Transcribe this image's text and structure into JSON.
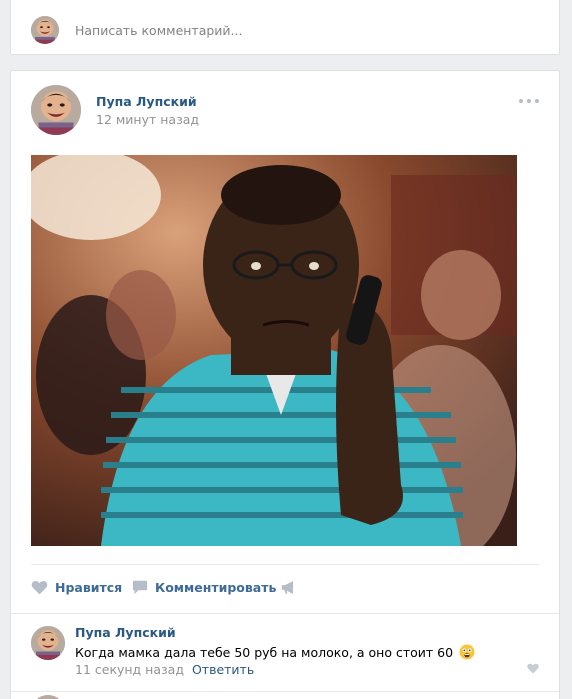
{
  "composer": {
    "placeholder": "Написать комментарий..."
  },
  "post": {
    "author": "Пупа Лупский",
    "time": "12 минут назад",
    "menu_icon": "more-dots-icon",
    "photo_alt": "meme-photo"
  },
  "actions": {
    "like_label": "Нравится",
    "comment_label": "Комментировать",
    "share_icon": "megaphone-icon"
  },
  "comment": {
    "author": "Пупа Лупский",
    "text": "Когда мамка дала тебе 50 руб на молоко, а оно стоит 60",
    "emoji": "scared-face-emoji",
    "time": "11 секунд назад",
    "reply_label": "Ответить"
  },
  "colors": {
    "link": "#2a5885",
    "action": "#3d6a98",
    "muted": "#939393",
    "background": "#edeef0",
    "icon": "#b5bec8"
  }
}
